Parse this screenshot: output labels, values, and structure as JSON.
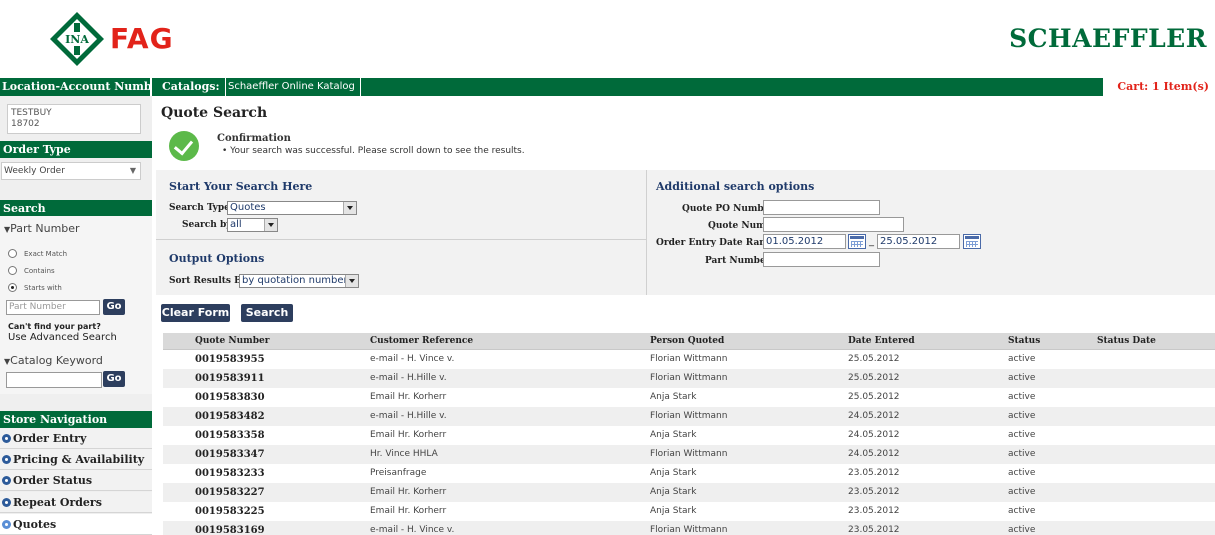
{
  "header": {
    "logo_left_text": "INA",
    "logo_brand": "FAG",
    "logo_right": "SCHAEFFLER"
  },
  "topbar": {
    "location_label": "Location-Account Number",
    "catalogs_label": "Catalogs:",
    "catalog_name": "Schaeffler Online Katalog",
    "cart": "Cart: 1 Item(s)"
  },
  "sidebar": {
    "account": {
      "name": "TESTBUY",
      "number": "18702"
    },
    "order_type_header": "Order Type",
    "order_type_value": "Weekly Order",
    "search_header": "Search",
    "part_number_toggle": "Part Number",
    "radios": [
      {
        "label": "Exact Match",
        "checked": false
      },
      {
        "label": "Contains",
        "checked": false
      },
      {
        "label": "Starts with",
        "checked": true
      }
    ],
    "part_number_placeholder": "Part Number",
    "go_label": "Go",
    "cant_find": "Can't find your part?",
    "advanced_search": "Use Advanced Search",
    "catalog_keyword_toggle": "Catalog Keyword",
    "store_nav_header": "Store Navigation",
    "nav_items": [
      "Order Entry",
      "Pricing & Availability",
      "Order Status",
      "Repeat Orders",
      "Quotes"
    ]
  },
  "main": {
    "title": "Quote Search",
    "confirmation_title": "Confirmation",
    "confirmation_message": "• Your search was successful. Please scroll down to see the results.",
    "start_search_title": "Start Your Search Here",
    "search_type_label": "Search Type",
    "search_type_value": "Quotes",
    "search_by_label": "Search by",
    "search_by_value": "all",
    "output_options_title": "Output Options",
    "sort_label": "Sort Results By",
    "sort_value": "by quotation number",
    "additional_title": "Additional search options",
    "quote_po_label": "Quote PO Number",
    "quote_number_label": "Quote Number",
    "date_range_label": "Order Entry Date Range",
    "date_from": "01.05.2012",
    "date_sep": "_",
    "date_to": "25.05.2012",
    "part_number_label": "Part Number",
    "clear_button": "Clear Form",
    "search_button": "Search"
  },
  "table": {
    "columns": [
      "Quote Number",
      "Customer Reference",
      "Person Quoted",
      "Date Entered",
      "Status",
      "Status Date"
    ],
    "rows": [
      [
        "0019583955",
        "e-mail - H. Vince v.",
        "Florian Wittmann",
        "25.05.2012",
        "active",
        ""
      ],
      [
        "0019583911",
        "e-mail - H.Hille v.",
        "Florian Wittmann",
        "25.05.2012",
        "active",
        ""
      ],
      [
        "0019583830",
        "Email Hr. Korherr",
        "Anja Stark",
        "25.05.2012",
        "active",
        ""
      ],
      [
        "0019583482",
        "e-mail - H.Hille v.",
        "Florian Wittmann",
        "24.05.2012",
        "active",
        ""
      ],
      [
        "0019583358",
        "Email Hr. Korherr",
        "Anja Stark",
        "24.05.2012",
        "active",
        ""
      ],
      [
        "0019583347",
        "Hr. Vince HHLA",
        "Florian Wittmann",
        "24.05.2012",
        "active",
        ""
      ],
      [
        "0019583233",
        "Preisanfrage",
        "Anja Stark",
        "23.05.2012",
        "active",
        ""
      ],
      [
        "0019583227",
        "Email Hr. Korherr",
        "Anja Stark",
        "23.05.2012",
        "active",
        ""
      ],
      [
        "0019583225",
        "Email Hr. Korherr",
        "Anja Stark",
        "23.05.2012",
        "active",
        ""
      ],
      [
        "0019583169",
        "e-mail - H. Vince v.",
        "Florian Wittmann",
        "23.05.2012",
        "active",
        ""
      ]
    ]
  },
  "colors": {
    "brand_green": "#006a3a",
    "brand_red": "#e2231a",
    "button_navy": "#2d3e5e",
    "confirm_green": "#5cb94a"
  }
}
